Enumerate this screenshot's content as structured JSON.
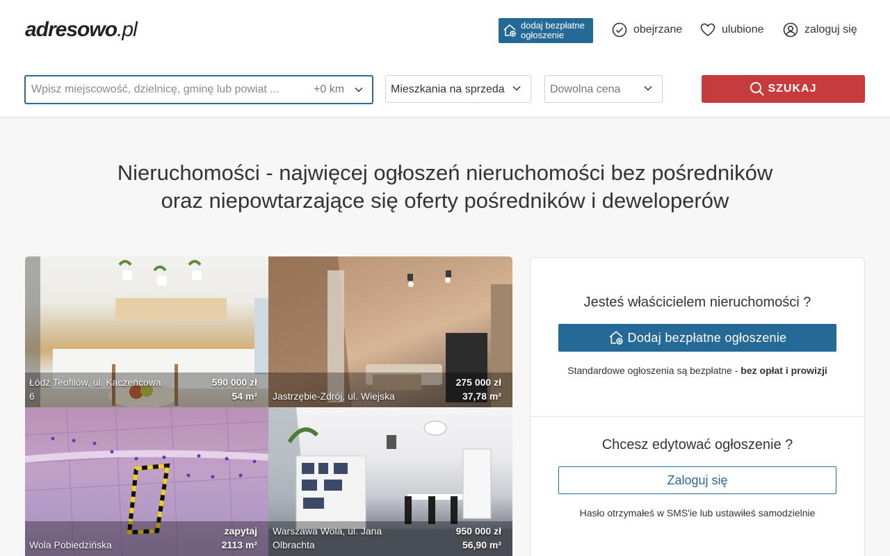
{
  "header": {
    "logo_main": "adresowo",
    "logo_tld": ".pl",
    "add_listing_label": "dodaj bezpłatne ogłoszenie",
    "add_listing_line1": "dodaj bezpłatne",
    "add_listing_line2": "ogłoszenie",
    "nav": [
      {
        "label": "obejrzane",
        "icon": "check-circle-icon"
      },
      {
        "label": "ulubione",
        "icon": "heart-icon"
      },
      {
        "label": "zaloguj się",
        "icon": "user-circle-icon"
      }
    ]
  },
  "search": {
    "location_placeholder": "Wpisz miejscowość, dzielnicę, gminę lub powiat ...",
    "location_value": "",
    "radius": "+0 km",
    "category": "Mieszkania na sprzeda",
    "price": "Dowolna cena",
    "button_label": "SZUKAJ"
  },
  "headline": {
    "line1": "Nieruchomości - najwięcej ogłoszeń nieruchomości bez pośredników",
    "line2": "oraz niepowtarzające się oferty pośredników i deweloperów"
  },
  "listings": [
    {
      "location": "Łódź Teofilów, ul. Kaczeńcowa 6",
      "price": "590 000 zł",
      "area": "54 m²"
    },
    {
      "location": "Jastrzębie-Zdrój, ul. Wiejska",
      "price": "275 000 zł",
      "area": "37,78 m²"
    },
    {
      "location": "Wola Pobiedzińska",
      "price": "zapytaj",
      "area": "2113 m²"
    },
    {
      "location": "Warszawa Wola, ul. Jana Olbrachta",
      "price": "950 000 zł",
      "area": "56,90 m²"
    }
  ],
  "owner_panel": {
    "title": "Jesteś właścicielem nieruchomości ?",
    "button_label": "Dodaj bezpłatne ogłoszenie",
    "note_prefix": "Standardowe ogłoszenia są bezpłatne - ",
    "note_bold": "bez opłat i prowizji"
  },
  "edit_panel": {
    "title": "Chcesz edytować ogłoszenie ?",
    "button_label": "Zaloguj się",
    "note": "Hasło otrzymałeś w SMS'ie lub ustawiłeś samodzielnie"
  },
  "colors": {
    "brand_blue": "#256a96",
    "search_red": "#c63b3b"
  }
}
